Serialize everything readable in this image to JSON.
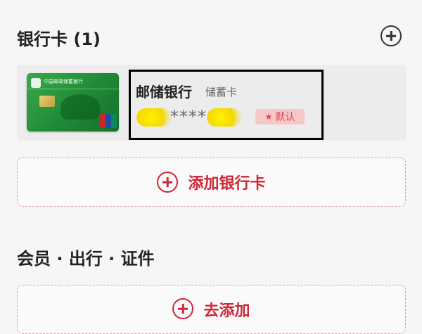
{
  "bank_section": {
    "title": "银行卡 (1)",
    "add_icon": "plus-circle-icon"
  },
  "card": {
    "bank_name": "邮储银行",
    "card_type": "储蓄卡",
    "masked_number": "****",
    "default_label": "默认",
    "card_image_text": "中国邮政储蓄银行",
    "badge_icon": "star-icon"
  },
  "add_card": {
    "label": "添加银行卡",
    "icon": "plus-circle-icon"
  },
  "member_section": {
    "title": "会员 · 出行 · 证件"
  },
  "to_add": {
    "label": "去添加",
    "icon": "plus-circle-icon"
  },
  "colors": {
    "accent_red": "#cf2838",
    "badge_bg": "#f6c7c7",
    "dashed_border": "#e39aa6"
  }
}
